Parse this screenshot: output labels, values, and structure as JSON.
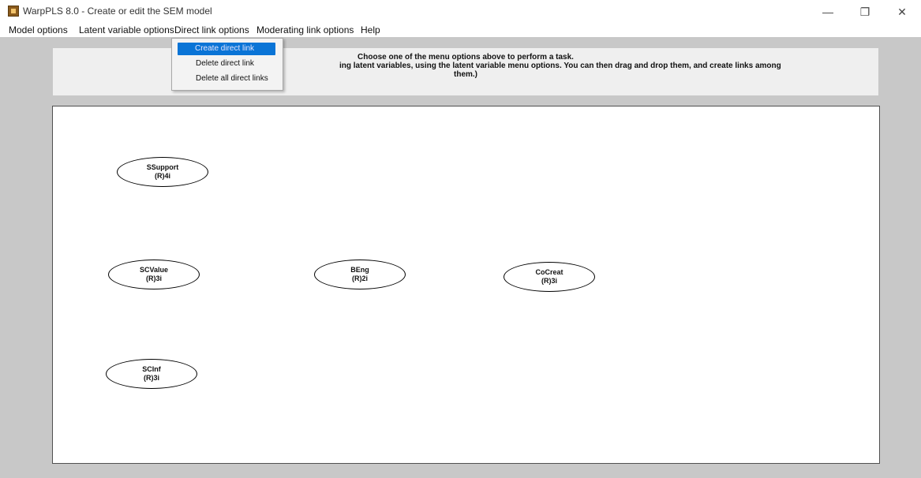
{
  "window": {
    "title": "WarpPLS 8.0 - Create or edit the SEM model",
    "minimize_symbol": "—",
    "restore_symbol": "❐",
    "close_symbol": "✕"
  },
  "menubar": [
    {
      "label": "Model options"
    },
    {
      "label": "Latent variable options"
    },
    {
      "label": "Direct link options"
    },
    {
      "label": "Moderating link options"
    },
    {
      "label": "Help"
    }
  ],
  "dropdown": {
    "items": [
      {
        "label": "Create direct link",
        "highlighted": true
      },
      {
        "label": "Delete direct link",
        "highlighted": false
      },
      {
        "label": "Delete all direct links",
        "highlighted": false
      }
    ]
  },
  "info_panel": {
    "line1": "Choose one of the menu options above to perform a task.",
    "line2": "ing latent variables, using the latent variable menu options. You can then drag and drop them, and create links among",
    "line3": "them.)"
  },
  "latent_variables": [
    {
      "name": "SSupport",
      "indicators": "(R)4i"
    },
    {
      "name": "SCValue",
      "indicators": "(R)3i"
    },
    {
      "name": "BEng",
      "indicators": "(R)2i"
    },
    {
      "name": "CoCreat",
      "indicators": "(R)3i"
    },
    {
      "name": "SCInf",
      "indicators": "(R)3i"
    }
  ],
  "colors": {
    "workspace_bg": "#c8c8c8",
    "menu_highlight": "#0a74d6",
    "app_icon": "#8a5a1c"
  }
}
